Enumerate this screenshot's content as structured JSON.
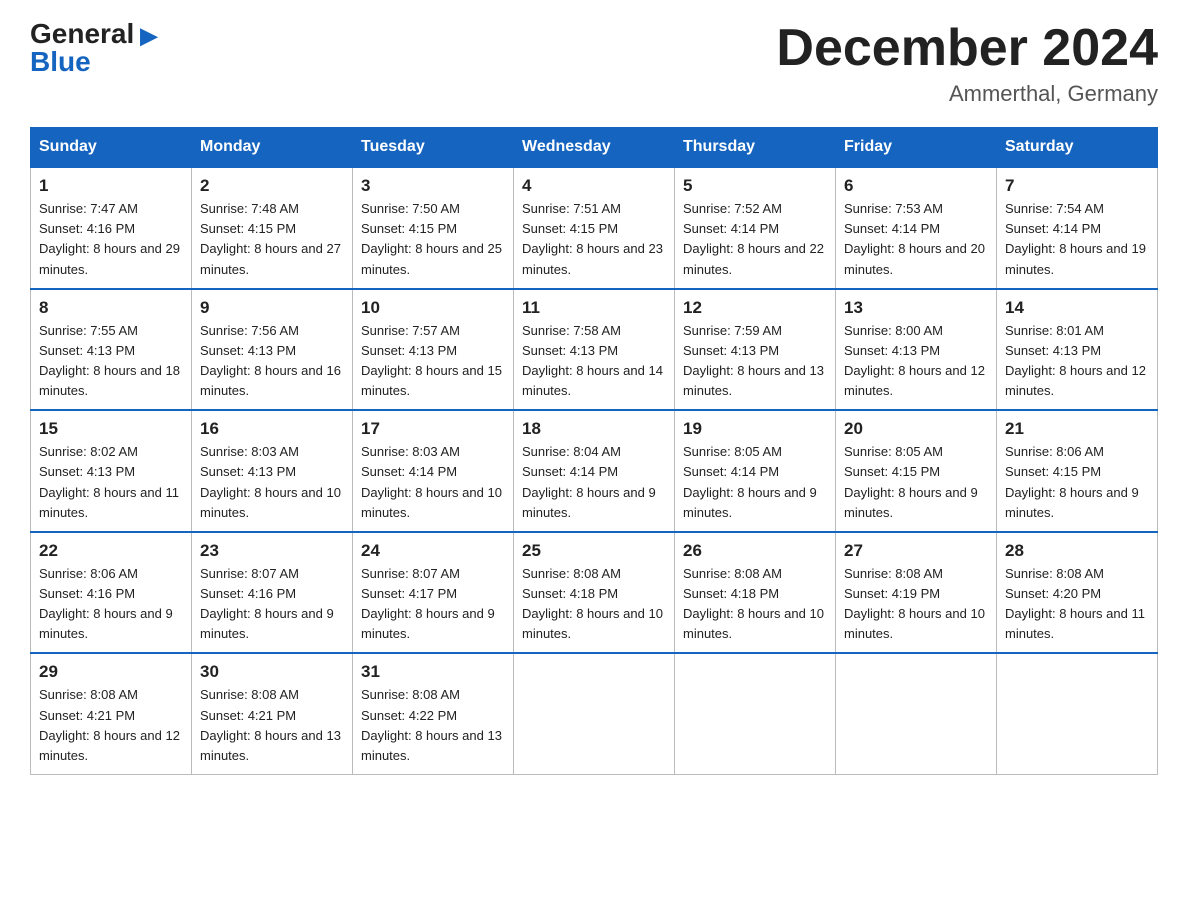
{
  "logo": {
    "general": "General",
    "blue": "Blue"
  },
  "title": "December 2024",
  "location": "Ammerthal, Germany",
  "days_of_week": [
    "Sunday",
    "Monday",
    "Tuesday",
    "Wednesday",
    "Thursday",
    "Friday",
    "Saturday"
  ],
  "weeks": [
    [
      {
        "day": "1",
        "sunrise": "7:47 AM",
        "sunset": "4:16 PM",
        "daylight": "8 hours and 29 minutes."
      },
      {
        "day": "2",
        "sunrise": "7:48 AM",
        "sunset": "4:15 PM",
        "daylight": "8 hours and 27 minutes."
      },
      {
        "day": "3",
        "sunrise": "7:50 AM",
        "sunset": "4:15 PM",
        "daylight": "8 hours and 25 minutes."
      },
      {
        "day": "4",
        "sunrise": "7:51 AM",
        "sunset": "4:15 PM",
        "daylight": "8 hours and 23 minutes."
      },
      {
        "day": "5",
        "sunrise": "7:52 AM",
        "sunset": "4:14 PM",
        "daylight": "8 hours and 22 minutes."
      },
      {
        "day": "6",
        "sunrise": "7:53 AM",
        "sunset": "4:14 PM",
        "daylight": "8 hours and 20 minutes."
      },
      {
        "day": "7",
        "sunrise": "7:54 AM",
        "sunset": "4:14 PM",
        "daylight": "8 hours and 19 minutes."
      }
    ],
    [
      {
        "day": "8",
        "sunrise": "7:55 AM",
        "sunset": "4:13 PM",
        "daylight": "8 hours and 18 minutes."
      },
      {
        "day": "9",
        "sunrise": "7:56 AM",
        "sunset": "4:13 PM",
        "daylight": "8 hours and 16 minutes."
      },
      {
        "day": "10",
        "sunrise": "7:57 AM",
        "sunset": "4:13 PM",
        "daylight": "8 hours and 15 minutes."
      },
      {
        "day": "11",
        "sunrise": "7:58 AM",
        "sunset": "4:13 PM",
        "daylight": "8 hours and 14 minutes."
      },
      {
        "day": "12",
        "sunrise": "7:59 AM",
        "sunset": "4:13 PM",
        "daylight": "8 hours and 13 minutes."
      },
      {
        "day": "13",
        "sunrise": "8:00 AM",
        "sunset": "4:13 PM",
        "daylight": "8 hours and 12 minutes."
      },
      {
        "day": "14",
        "sunrise": "8:01 AM",
        "sunset": "4:13 PM",
        "daylight": "8 hours and 12 minutes."
      }
    ],
    [
      {
        "day": "15",
        "sunrise": "8:02 AM",
        "sunset": "4:13 PM",
        "daylight": "8 hours and 11 minutes."
      },
      {
        "day": "16",
        "sunrise": "8:03 AM",
        "sunset": "4:13 PM",
        "daylight": "8 hours and 10 minutes."
      },
      {
        "day": "17",
        "sunrise": "8:03 AM",
        "sunset": "4:14 PM",
        "daylight": "8 hours and 10 minutes."
      },
      {
        "day": "18",
        "sunrise": "8:04 AM",
        "sunset": "4:14 PM",
        "daylight": "8 hours and 9 minutes."
      },
      {
        "day": "19",
        "sunrise": "8:05 AM",
        "sunset": "4:14 PM",
        "daylight": "8 hours and 9 minutes."
      },
      {
        "day": "20",
        "sunrise": "8:05 AM",
        "sunset": "4:15 PM",
        "daylight": "8 hours and 9 minutes."
      },
      {
        "day": "21",
        "sunrise": "8:06 AM",
        "sunset": "4:15 PM",
        "daylight": "8 hours and 9 minutes."
      }
    ],
    [
      {
        "day": "22",
        "sunrise": "8:06 AM",
        "sunset": "4:16 PM",
        "daylight": "8 hours and 9 minutes."
      },
      {
        "day": "23",
        "sunrise": "8:07 AM",
        "sunset": "4:16 PM",
        "daylight": "8 hours and 9 minutes."
      },
      {
        "day": "24",
        "sunrise": "8:07 AM",
        "sunset": "4:17 PM",
        "daylight": "8 hours and 9 minutes."
      },
      {
        "day": "25",
        "sunrise": "8:08 AM",
        "sunset": "4:18 PM",
        "daylight": "8 hours and 10 minutes."
      },
      {
        "day": "26",
        "sunrise": "8:08 AM",
        "sunset": "4:18 PM",
        "daylight": "8 hours and 10 minutes."
      },
      {
        "day": "27",
        "sunrise": "8:08 AM",
        "sunset": "4:19 PM",
        "daylight": "8 hours and 10 minutes."
      },
      {
        "day": "28",
        "sunrise": "8:08 AM",
        "sunset": "4:20 PM",
        "daylight": "8 hours and 11 minutes."
      }
    ],
    [
      {
        "day": "29",
        "sunrise": "8:08 AM",
        "sunset": "4:21 PM",
        "daylight": "8 hours and 12 minutes."
      },
      {
        "day": "30",
        "sunrise": "8:08 AM",
        "sunset": "4:21 PM",
        "daylight": "8 hours and 13 minutes."
      },
      {
        "day": "31",
        "sunrise": "8:08 AM",
        "sunset": "4:22 PM",
        "daylight": "8 hours and 13 minutes."
      },
      {
        "day": "",
        "sunrise": "",
        "sunset": "",
        "daylight": ""
      },
      {
        "day": "",
        "sunrise": "",
        "sunset": "",
        "daylight": ""
      },
      {
        "day": "",
        "sunrise": "",
        "sunset": "",
        "daylight": ""
      },
      {
        "day": "",
        "sunrise": "",
        "sunset": "",
        "daylight": ""
      }
    ]
  ]
}
